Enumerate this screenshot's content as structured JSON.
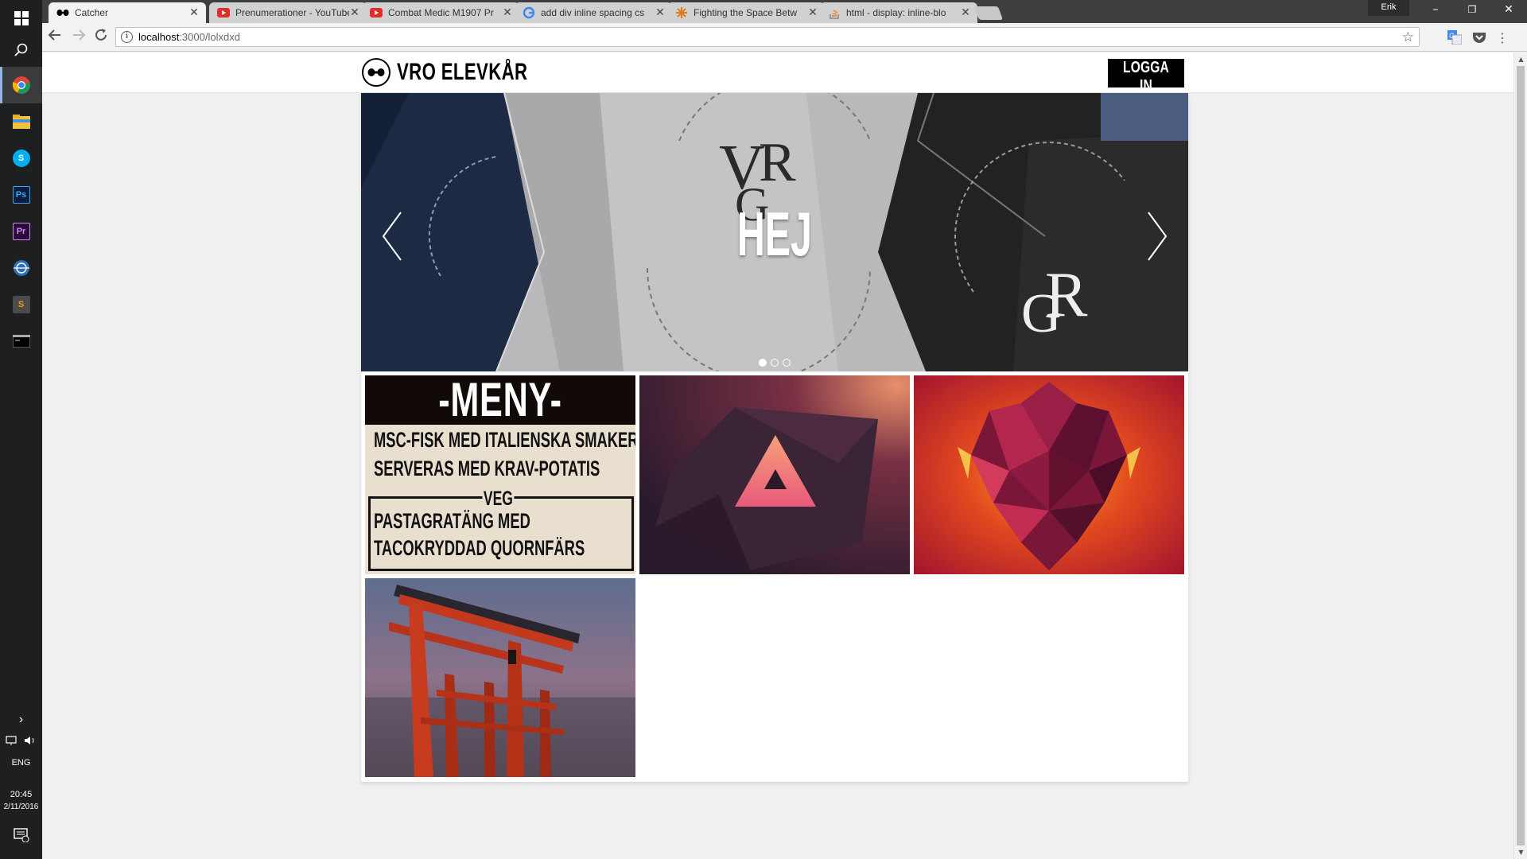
{
  "browser": {
    "tabs": [
      {
        "title": "Catcher",
        "favicon": "catcher-icon"
      },
      {
        "title": "Prenumerationer - YouTube",
        "favicon": "youtube-icon"
      },
      {
        "title": "Combat Medic M1907 Pr",
        "favicon": "youtube-icon"
      },
      {
        "title": "add div inline spacing cs",
        "favicon": "google-icon"
      },
      {
        "title": "Fighting the Space Betw",
        "favicon": "css-tricks-icon"
      },
      {
        "title": "html - display: inline-blo",
        "favicon": "stackoverflow-icon"
      }
    ],
    "profile_name": "Erik",
    "url_host": "localhost",
    "url_path": ":3000/lolxdxd"
  },
  "taskbar": {
    "language": "ENG",
    "time": "20:45",
    "date": "2/11/2016"
  },
  "site": {
    "brand": "VRO ELEVKÅR",
    "login_label": "LOGGA IN"
  },
  "carousel": {
    "caption": "HEJ",
    "slide_count": 3,
    "active_slide": 1
  },
  "menu": {
    "title": "-MENY-",
    "lines": [
      "MSC-FISK MED ITALIENSKA SMAKER",
      "SERVERAS MED KRAV-POTATIS"
    ],
    "veg_label": "VEG",
    "veg_lines": [
      "PASTAGRATÄNG MED",
      "TACOKRYDDAD QUORNFÄRS"
    ]
  },
  "colors": {
    "brand_black": "#000000",
    "menu_bg": "#e9dfcf",
    "menu_header": "#120a08"
  }
}
